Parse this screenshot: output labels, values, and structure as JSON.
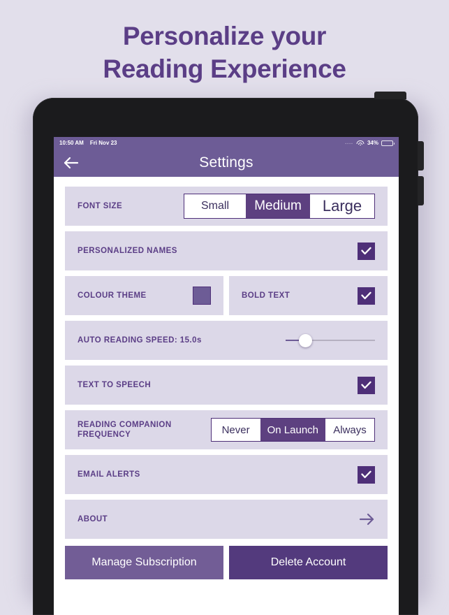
{
  "headline": {
    "line1": "Personalize your",
    "line2": "Reading Experience"
  },
  "statusbar": {
    "time": "10:50 AM",
    "date": "Fri Nov 23",
    "signal_dots": "....",
    "wifi_icon": "wifi-icon",
    "battery_percent": "34%",
    "battery_level": 34
  },
  "navbar": {
    "back_icon": "back-arrow-icon",
    "title": "Settings"
  },
  "settings": {
    "font_size": {
      "label": "FONT SIZE",
      "options": [
        "Small",
        "Medium",
        "Large"
      ],
      "selected": "Medium"
    },
    "personalized_names": {
      "label": "PERSONALIZED NAMES",
      "checked": true,
      "check_icon": "checkmark-icon"
    },
    "colour_theme": {
      "label": "COLOUR THEME",
      "swatch_color": "#6d5c96"
    },
    "bold_text": {
      "label": "BOLD TEXT",
      "checked": true,
      "check_icon": "checkmark-icon"
    },
    "auto_reading_speed": {
      "label": "AUTO READING SPEED: 15.0s",
      "value": "15.0s",
      "slider_position_percent": 22
    },
    "text_to_speech": {
      "label": "TEXT TO SPEECH",
      "checked": true,
      "check_icon": "checkmark-icon"
    },
    "reading_companion_frequency": {
      "label_line1": "READING COMPANION",
      "label_line2": "FREQUENCY",
      "options": [
        "Never",
        "On Launch",
        "Always"
      ],
      "selected": "On Launch"
    },
    "email_alerts": {
      "label": "EMAIL ALERTS",
      "checked": true,
      "check_icon": "checkmark-icon"
    },
    "about": {
      "label": "ABOUT",
      "arrow_icon": "arrow-right-icon"
    }
  },
  "bottom_buttons": {
    "manage_subscription": "Manage Subscription",
    "delete_account": "Delete Account"
  },
  "colors": {
    "page_background": "#e2dfeb",
    "brand_purple": "#5b3e86",
    "nav_purple": "#6d5c96",
    "accent_dark": "#4e2f78",
    "card_background": "#dcd8e8",
    "selected_segment": "#5d4080",
    "manage_button": "#725d96",
    "delete_button": "#533a7d"
  }
}
